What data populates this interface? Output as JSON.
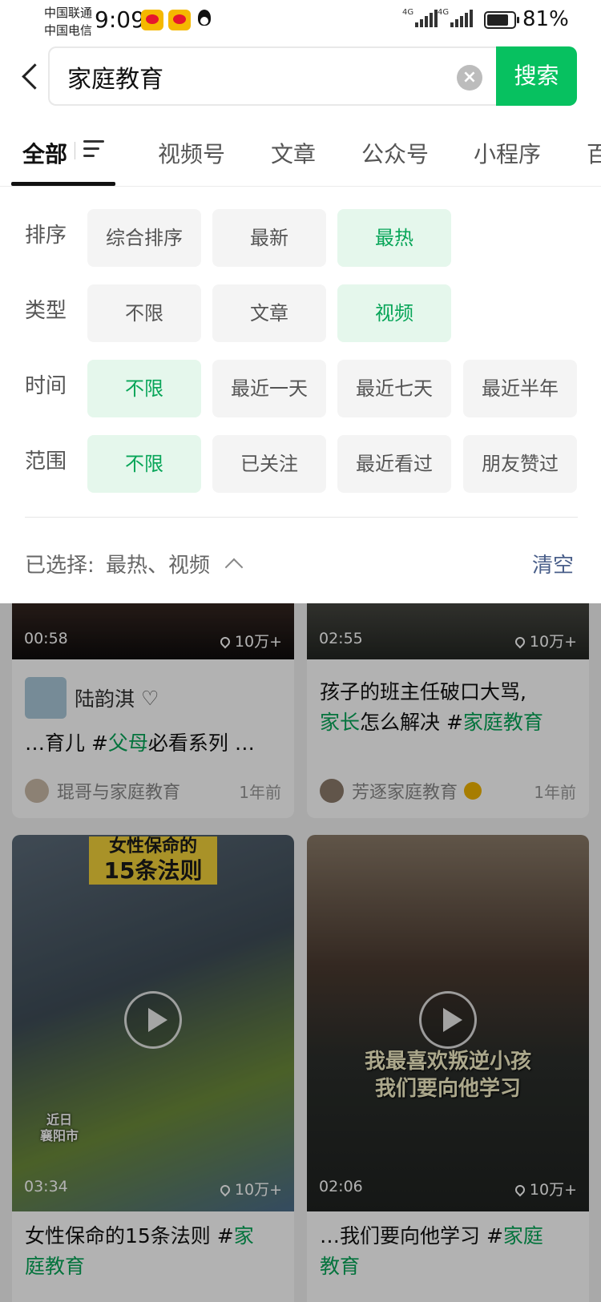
{
  "status_bar": {
    "carrier_1": "中国联通",
    "carrier_2": "中国电信",
    "time": "9:09",
    "battery_percent": "81%",
    "battery_level": 0.81,
    "network_1": "4G",
    "network_2": "4G"
  },
  "search": {
    "query": "家庭教育",
    "search_button": "搜索"
  },
  "tabs": [
    "全部",
    "视频号",
    "文章",
    "公众号",
    "小程序",
    "百"
  ],
  "filters": {
    "sort": {
      "label": "排序",
      "options": [
        "综合排序",
        "最新",
        "最热"
      ],
      "selected": "最热"
    },
    "type": {
      "label": "类型",
      "options": [
        "不限",
        "文章",
        "视频"
      ],
      "selected": "视频"
    },
    "time": {
      "label": "时间",
      "options": [
        "不限",
        "最近一天",
        "最近七天",
        "最近半年"
      ],
      "selected": "不限"
    },
    "scope": {
      "label": "范围",
      "options": [
        "不限",
        "已关注",
        "最近看过",
        "朋友赞过"
      ],
      "selected": "不限"
    }
  },
  "selected_summary": {
    "prefix": "已选择:",
    "value": "最热、视频",
    "clear": "清空"
  },
  "results": [
    {
      "duration": "00:58",
      "likes": "10万+",
      "uploader": "陆韵淇",
      "title_parts": [
        "…育儿 #",
        "父母",
        "必看系列 …"
      ],
      "author": "琨哥与家庭教育",
      "time_ago": "1年前"
    },
    {
      "duration": "02:55",
      "likes": "10万+",
      "title_line1": "孩子的班主任破口大骂,",
      "title_line2_parts": [
        "家长",
        "怎么解决 #",
        "家庭教育"
      ],
      "author": "芳逐家庭教育",
      "time_ago": "1年前"
    },
    {
      "duration": "03:34",
      "likes": "10万+",
      "caption_top": "女性保命的",
      "caption_main": "15条法则",
      "caption_place": "近日\n襄阳市",
      "title_line1_parts": [
        "女性保命的15条法则 #",
        "家"
      ],
      "title_line2": "庭教育"
    },
    {
      "duration": "02:06",
      "likes": "10万+",
      "caption_line1": "我最喜欢叛逆小孩",
      "caption_line2": "我们要向他学习",
      "title_line1_parts": [
        "…我们要向他学习 #",
        "家庭"
      ],
      "title_line2": "教育"
    }
  ],
  "colors": {
    "accent_green": "#07c160",
    "highlight_green": "#07a558",
    "selected_chip_bg": "#e5f7ec",
    "link_blue": "#4a5f8a"
  }
}
